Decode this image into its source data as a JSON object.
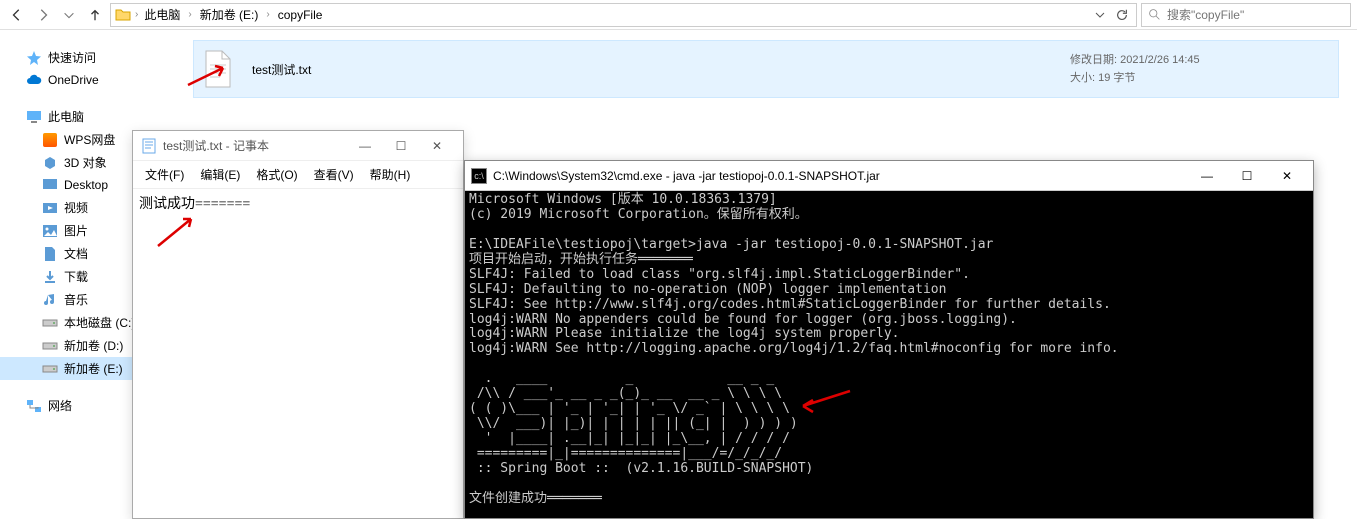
{
  "nav": {
    "breadcrumbs": [
      "此电脑",
      "新加卷 (E:)",
      "copyFile"
    ],
    "search_placeholder": "搜索\"copyFile\""
  },
  "sidebar": {
    "groups": [
      {
        "items": [
          {
            "icon": "star",
            "label": "快速访问"
          },
          {
            "icon": "cloud",
            "label": "OneDrive"
          }
        ]
      },
      {
        "items": [
          {
            "icon": "monitor",
            "label": "此电脑"
          },
          {
            "icon": "wps",
            "label": "WPS网盘",
            "indented": true
          },
          {
            "icon": "3d",
            "label": "3D 对象",
            "indented": true
          },
          {
            "icon": "desktop",
            "label": "Desktop",
            "indented": true
          },
          {
            "icon": "video",
            "label": "视频",
            "indented": true
          },
          {
            "icon": "pic",
            "label": "图片",
            "indented": true
          },
          {
            "icon": "doc",
            "label": "文档",
            "indented": true
          },
          {
            "icon": "dl",
            "label": "下载",
            "indented": true
          },
          {
            "icon": "music",
            "label": "音乐",
            "indented": true
          },
          {
            "icon": "drive",
            "label": "本地磁盘 (C:)",
            "indented": true
          },
          {
            "icon": "drive",
            "label": "新加卷 (D:)",
            "indented": true
          },
          {
            "icon": "drive",
            "label": "新加卷 (E:)",
            "indented": true,
            "selected": true
          }
        ]
      },
      {
        "items": [
          {
            "icon": "net",
            "label": "网络"
          }
        ]
      }
    ]
  },
  "file": {
    "name": "test测试.txt",
    "date_label": "修改日期:",
    "date_value": "2021/2/26 14:45",
    "size_label": "大小:",
    "size_value": "19 字节"
  },
  "notepad": {
    "title": "test测试.txt - 记事本",
    "menus": [
      "文件(F)",
      "编辑(E)",
      "格式(O)",
      "查看(V)",
      "帮助(H)"
    ],
    "content": "测试成功======="
  },
  "cmd": {
    "title": "C:\\Windows\\System32\\cmd.exe - java  -jar testiopoj-0.0.1-SNAPSHOT.jar",
    "lines": [
      "Microsoft Windows [版本 10.0.18363.1379]",
      "(c) 2019 Microsoft Corporation。保留所有权利。",
      "",
      "E:\\IDEAFile\\testiopoj\\target>java -jar testiopoj-0.0.1-SNAPSHOT.jar",
      "项目开始启动，开始执行任务═══════",
      "SLF4J: Failed to load class \"org.slf4j.impl.StaticLoggerBinder\".",
      "SLF4J: Defaulting to no-operation (NOP) logger implementation",
      "SLF4J: See http://www.slf4j.org/codes.html#StaticLoggerBinder for further details.",
      "log4j:WARN No appenders could be found for logger (org.jboss.logging).",
      "log4j:WARN Please initialize the log4j system properly.",
      "log4j:WARN See http://logging.apache.org/log4j/1.2/faq.html#noconfig for more info.",
      "",
      "  .   ____          _            __ _ _",
      " /\\\\ / ___'_ __ _ _(_)_ __  __ _ \\ \\ \\ \\",
      "( ( )\\___ | '_ | '_| | '_ \\/ _` | \\ \\ \\ \\",
      " \\\\/  ___)| |_)| | | | | || (_| |  ) ) ) )",
      "  '  |____| .__|_| |_|_| |_\\__, | / / / /",
      " =========|_|==============|___/=/_/_/_/",
      " :: Spring Boot ::  (v2.1.16.BUILD-SNAPSHOT)",
      "",
      "文件创建成功═══════"
    ]
  }
}
